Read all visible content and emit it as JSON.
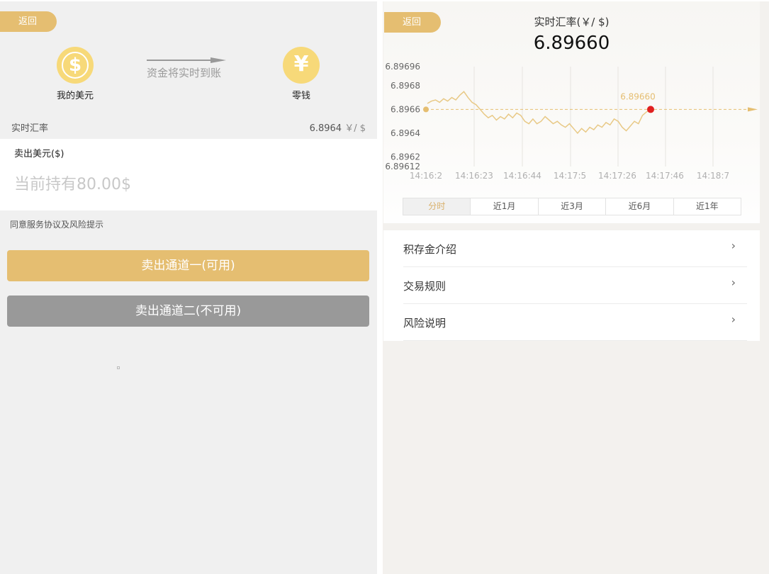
{
  "left": {
    "back_label": "返回",
    "my_usd_label": "我的美元",
    "change_label": "零钱",
    "transfer_text": "资金将实时到账",
    "rate_label": "实时汇率",
    "rate_value": "6.8964",
    "rate_unit": "￥/ $",
    "sell_label": "卖出美元($)",
    "sell_placeholder": "当前持有80.00$",
    "agree_text": "同意服务协议及风险提示",
    "channel1_label": "卖出通道一(可用)",
    "channel2_label": "卖出通道二(不可用)"
  },
  "right": {
    "back_label": "返回",
    "title": "实时汇率(￥/ $)",
    "price": "6.89660",
    "tabs": [
      {
        "label": "分时",
        "active": true
      },
      {
        "label": "近1月",
        "active": false
      },
      {
        "label": "近3月",
        "active": false
      },
      {
        "label": "近6月",
        "active": false
      },
      {
        "label": "近1年",
        "active": false
      }
    ],
    "menu": [
      {
        "label": "积存金介绍"
      },
      {
        "label": "交易规则"
      },
      {
        "label": "风险说明"
      }
    ]
  },
  "colors": {
    "accent": "#e5be71",
    "disabled": "#999999",
    "coin": "#f7d979",
    "marker": "#e02020"
  },
  "icons": {
    "usd": "dollar-coin-icon",
    "cny": "yuan-coin-icon",
    "chevron": "chevron-right-icon"
  },
  "chart_data": {
    "type": "line",
    "title": "",
    "xlabel": "",
    "ylabel": "",
    "x_ticks": [
      "14:16:2",
      "14:16:23",
      "14:16:44",
      "14:17:5",
      "14:17:26",
      "14:17:46",
      "14:18:7"
    ],
    "y_ticks": [
      "6.89696",
      "6.8968",
      "6.8966",
      "6.8964",
      "6.8962",
      "6.89612"
    ],
    "ylim": [
      6.89612,
      6.89696
    ],
    "reference_line": 6.8966,
    "current_label": "6.89660",
    "series": [
      {
        "values": [
          6.89665,
          6.89667,
          6.89668,
          6.89666,
          6.89669,
          6.89667,
          6.8967,
          6.89668,
          6.89672,
          6.89675,
          6.8967,
          6.89666,
          6.89664,
          6.8966,
          6.89656,
          6.89653,
          6.89655,
          6.89651,
          6.89654,
          6.89652,
          6.89656,
          6.89653,
          6.89657,
          6.89655,
          6.8965,
          6.89648,
          6.89652,
          6.89648,
          6.8965,
          6.89654,
          6.89651,
          6.89648,
          6.8965,
          6.89647,
          6.89645,
          6.89648,
          6.89644,
          6.8964,
          6.89644,
          6.89641,
          6.89645,
          6.89643,
          6.89647,
          6.89645,
          6.89649,
          6.89647,
          6.89652,
          6.8965,
          6.89645,
          6.89642,
          6.89646,
          6.8965,
          6.89648,
          6.89655,
          6.89658,
          6.8966
        ]
      }
    ]
  }
}
